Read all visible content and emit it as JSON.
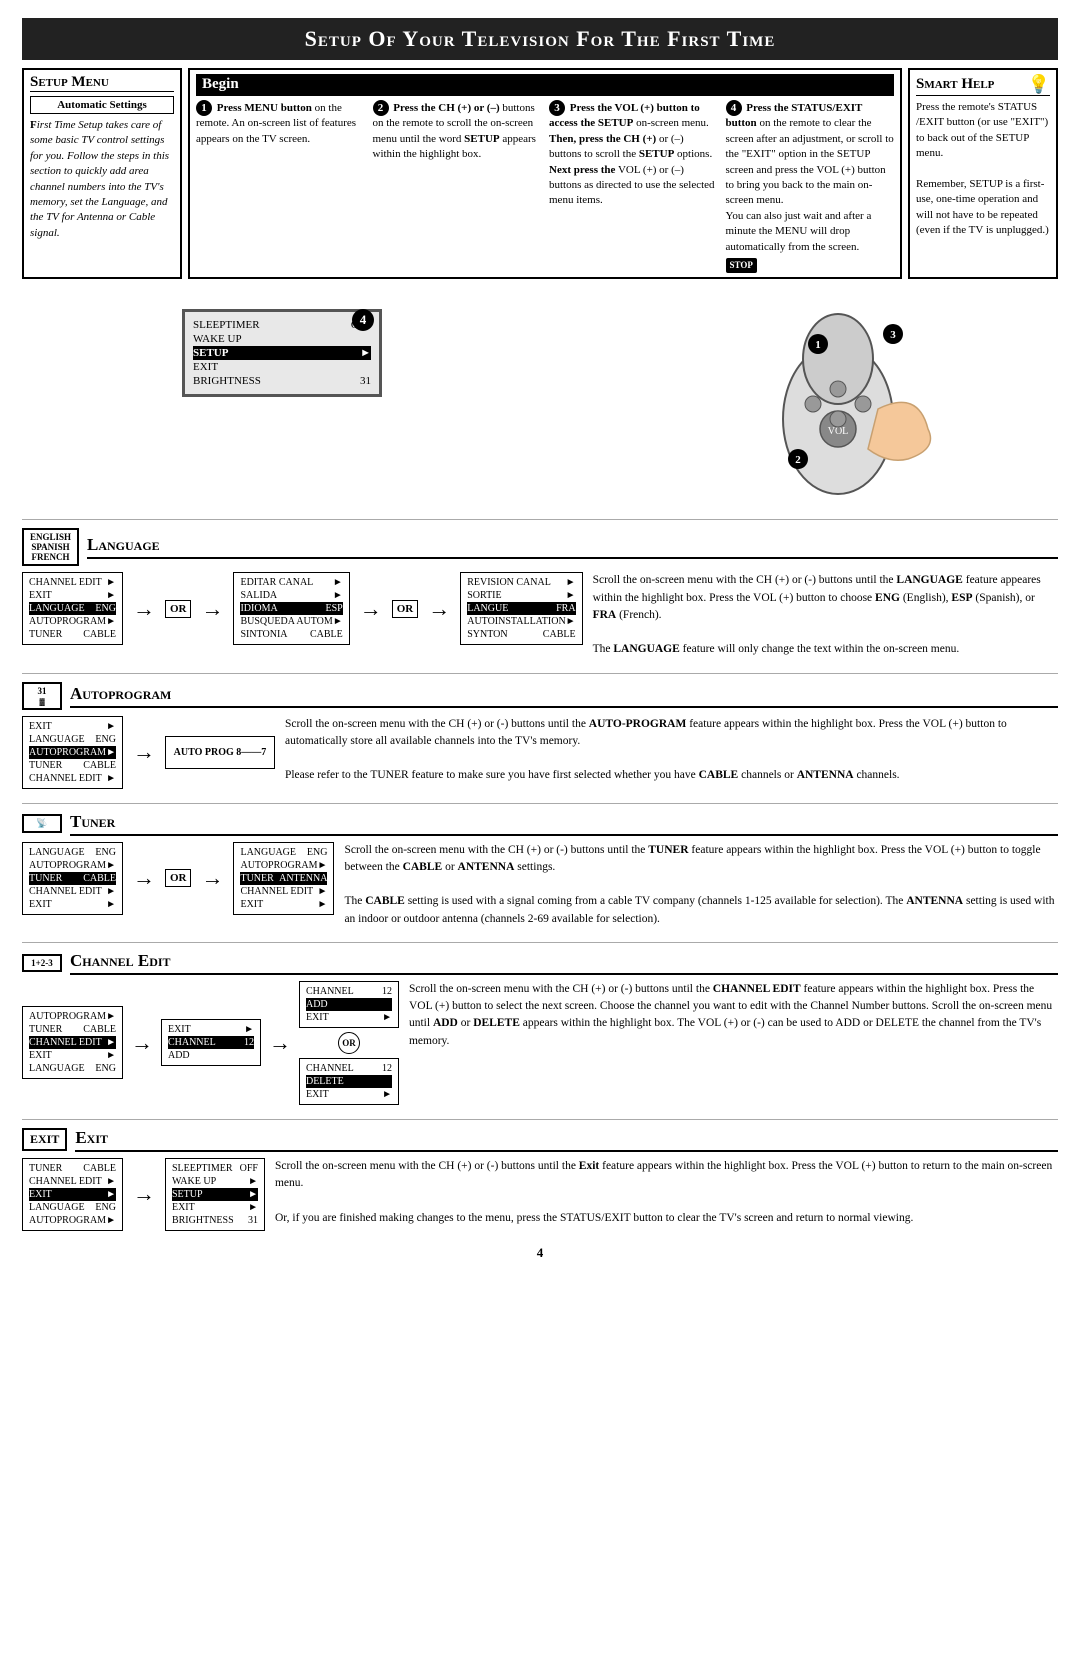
{
  "page": {
    "title": "Setup Of Your Television For The First Time",
    "page_number": "4"
  },
  "setup_menu": {
    "title": "Setup Menu",
    "auto_settings_title": "Automatic Settings",
    "auto_settings_text": "First Time Setup takes care of some basic TV control settings for you. Follow the steps in this section to quickly add area channel numbers into the TV's memory, set the Language, and the TV for Antenna or Cable signal."
  },
  "begin": {
    "title": "Begin",
    "steps": [
      {
        "num": "1",
        "text": "Press MENU button on the remote. An on-screen list of features appears on the TV screen."
      },
      {
        "num": "2",
        "text": "Press the CH (+) or (–) buttons on the remote to scroll the on-screen menu until the word SETUP appears within the highlight box."
      },
      {
        "num": "3",
        "text": "Press the VOL (+) button to access the SETUP on-screen menu. Then, press the CH (+) or (–) buttons to scroll the SETUP options. Next press the VOL (+) or (–) buttons as directed to use the selected menu items."
      },
      {
        "num": "4",
        "text": "Press the STATUS/EXIT button on the remote to clear the screen after an adjustment, or scroll to the \"EXIT\" option in the SETUP screen and press the VOL (+) button to bring you back to the main on-screen menu.\nYou can also just wait and after a minute the MENU will drop automatically from the screen."
      }
    ],
    "stop_label": "STOP"
  },
  "smart_help": {
    "title": "Smart Help",
    "text": "Press the remote's STATUS /EXIT button (or use \"EXIT\") to back out of the SETUP menu.\n\nRemember, SETUP is a first-use, one-time operation and will not have to be repeated (even if the TV is unplugged.)"
  },
  "tv_menu": {
    "rows": [
      {
        "label": "SLEEPTIMER",
        "value": "OFF"
      },
      {
        "label": "WAKE UP",
        "value": ""
      },
      {
        "label": "SETUP",
        "value": "►",
        "highlighted": true
      },
      {
        "label": "EXIT",
        "value": "►"
      },
      {
        "label": "BRIGHTNESS",
        "value": "31"
      }
    ]
  },
  "language_section": {
    "title": "Language",
    "icon": "",
    "menu1": {
      "rows": [
        {
          "label": "CHANNEL EDIT",
          "value": "►"
        },
        {
          "label": "EXIT",
          "value": "►"
        },
        {
          "label": "LANGUAGE",
          "value": "ENG",
          "highlighted": true
        },
        {
          "label": "AUTOPROGRAM",
          "value": "►"
        },
        {
          "label": "TUNER",
          "value": "CABLE"
        }
      ]
    },
    "menu2": {
      "rows": [
        {
          "label": "EDITAR CANAL",
          "value": "►"
        },
        {
          "label": "SALIDA",
          "value": "►"
        },
        {
          "label": "IDIOMA",
          "value": "ESP",
          "highlighted": true
        },
        {
          "label": "BUSQUEDA AUTOM",
          "value": "►"
        },
        {
          "label": "SINTONIA",
          "value": "CABLE"
        }
      ]
    },
    "menu3": {
      "rows": [
        {
          "label": "REVISION CANAL",
          "value": "►"
        },
        {
          "label": "SORTIE",
          "value": "►"
        },
        {
          "label": "LANGUE",
          "value": "FRA",
          "highlighted": true
        },
        {
          "label": "AUTOINSTALLATION",
          "value": "►"
        },
        {
          "label": "SYNTON",
          "value": "CABLE"
        }
      ]
    },
    "or_label": "OR",
    "description": "Scroll the on-screen menu with the CH (+) or (-) buttons until the LANGUAGE feature appeares within the highlight box. Press the VOL (+) button to choose ENG (English), ESP (Spanish), or FRA (French).\n\nThe LANGUAGE feature will only change the text within the on-screen menu."
  },
  "autoprogram_section": {
    "title": "Autoprogram",
    "icon": "31",
    "menu1": {
      "rows": [
        {
          "label": "EXIT",
          "value": "►"
        },
        {
          "label": "LANGUAGE",
          "value": "ENG"
        },
        {
          "label": "AUTOPROGRAM",
          "value": "►",
          "highlighted": true
        },
        {
          "label": "TUNER",
          "value": "CABLE"
        },
        {
          "label": "CHANNEL EDIT",
          "value": "►"
        }
      ]
    },
    "menu2": {
      "label": "AUTO PROG 8——7"
    },
    "description": "Scroll the on-screen menu with the CH (+) or (-) buttons until the AUTOPROGRAM feature appears within the highlight box. Press the VOL (+) button to automatically store all available channels into the TV's memory.\n\nPlease refer to the TUNER feature to make sure you have first selected whether you have CABLE channels or ANTENNA channels."
  },
  "tuner_section": {
    "title": "Tuner",
    "icon": "",
    "menu1": {
      "rows": [
        {
          "label": "LANGUAGE",
          "value": "ENG"
        },
        {
          "label": "AUTOPROGRAM",
          "value": "►"
        },
        {
          "label": "TUNER",
          "value": "CABLE",
          "highlighted": true
        },
        {
          "label": "CHANNEL EDIT",
          "value": "►"
        },
        {
          "label": "EXIT",
          "value": "►"
        }
      ]
    },
    "menu2": {
      "rows": [
        {
          "label": "LANGUAGE",
          "value": "ENG"
        },
        {
          "label": "AUTOPROGRAM",
          "value": "►"
        },
        {
          "label": "TUNER",
          "value": "ANTENNA",
          "highlighted": true
        },
        {
          "label": "CHANNEL EDIT",
          "value": "►"
        },
        {
          "label": "EXIT",
          "value": "►"
        }
      ]
    },
    "or_label": "OR",
    "description": "Scroll the on-screen menu with the CH (+) or (-) buttons until the TUNER feature appears within the highlight box. Press the VOL (+) button to toggle between the CABLE or ANTENNA settings.\n\nThe CABLE setting is used with a signal coming from a cable TV company (channels 1-125 available for selection). The ANTENNA setting is used with an indoor or outdoor antenna (channels 2-69 available for selection)."
  },
  "channel_edit_section": {
    "title": "Channel Edit",
    "icon": "1+2-3",
    "menu1": {
      "rows": [
        {
          "label": "AUTOPROGRAM",
          "value": "►"
        },
        {
          "label": "TUNER",
          "value": "CABLE"
        },
        {
          "label": "CHANNEL EDIT",
          "value": "►",
          "highlighted": true
        },
        {
          "label": "EXIT",
          "value": "►"
        },
        {
          "label": "LANGUAGE",
          "value": "ENG"
        }
      ]
    },
    "menu2": {
      "rows": [
        {
          "label": "EXIT",
          "value": "►"
        },
        {
          "label": "CHANNEL",
          "value": "12",
          "highlighted": true
        },
        {
          "label": "ADD",
          "value": ""
        }
      ]
    },
    "menu3a": {
      "rows": [
        {
          "label": "CHANNEL",
          "value": "12"
        },
        {
          "label": "ADD",
          "value": "",
          "highlighted": true
        },
        {
          "label": "EXIT",
          "value": "►"
        }
      ]
    },
    "menu3b": {
      "rows": [
        {
          "label": "CHANNEL",
          "value": "12"
        },
        {
          "label": "DELETE",
          "value": "",
          "highlighted": true
        },
        {
          "label": "EXIT",
          "value": "►"
        }
      ]
    },
    "or_label": "OR",
    "description": "Scroll the on-screen menu with the CH (+) or (-) buttons until the CHANNEL EDIT feature appears within the highlight box. Press the VOL (+) button to select the next screen. Choose the channel you want to edit with the Channel Number buttons. Scroll the on-screen menu until ADD or DELETE appears within the highlight box. The VOL (+) or (-) can be used to ADD or DELETE the channel from the TV's memory."
  },
  "exit_section": {
    "title": "Exit",
    "icon": "EXIT",
    "menu1": {
      "rows": [
        {
          "label": "TUNER",
          "value": "CABLE"
        },
        {
          "label": "CHANNEL EDIT",
          "value": "►"
        },
        {
          "label": "EXIT",
          "value": "►",
          "highlighted": true
        },
        {
          "label": "LANGUAGE",
          "value": "ENG"
        },
        {
          "label": "AUTOPROGRAM",
          "value": "►"
        }
      ]
    },
    "menu2": {
      "rows": [
        {
          "label": "SLEEPTIMER",
          "value": "OFF"
        },
        {
          "label": "WAKE UP",
          "value": "►"
        },
        {
          "label": "SETUP",
          "value": "►",
          "highlighted": true
        },
        {
          "label": "EXIT",
          "value": "►"
        },
        {
          "label": "BRIGHTNESS",
          "value": "31"
        }
      ]
    },
    "description": "Scroll the on-screen menu with the CH (+) or (-) buttons until the Exit feature appears within the highlight box. Press the VOL (+) button to return to the main on-screen menu.\n\nOr, if you are finished making changes to the menu, press the STATUS/EXIT button to clear the TV's screen and return to normal viewing."
  }
}
